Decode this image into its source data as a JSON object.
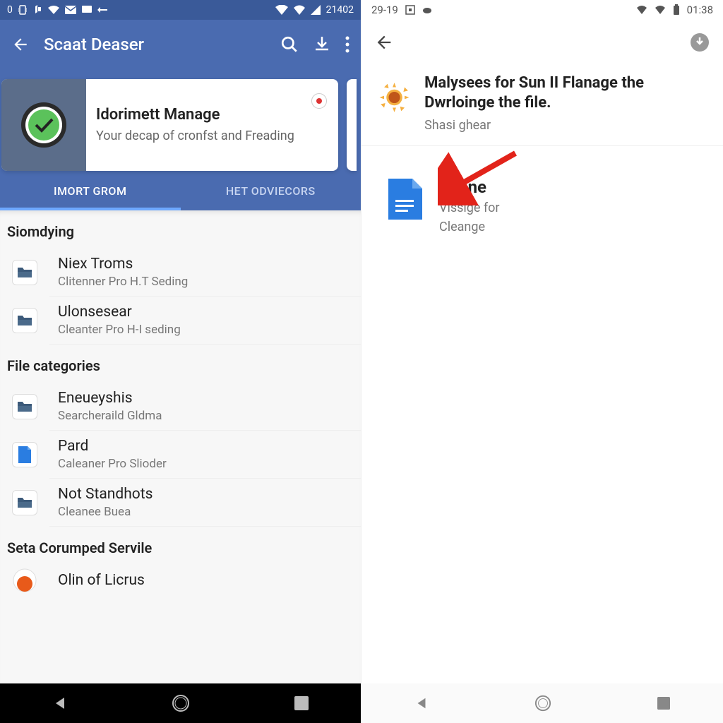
{
  "left": {
    "status": {
      "time": "21402"
    },
    "appbar": {
      "title": "Scaat Deaser"
    },
    "card": {
      "title": "Idorimett Manage",
      "subtitle": "Your decap of cronfst and Freading"
    },
    "tabs": [
      "IMORT GROM",
      "HET ODVIECORS"
    ],
    "sections": [
      {
        "header": "Siomdying",
        "items": [
          {
            "title": "Niex Troms",
            "subtitle": "Clitenner Pro H.T Seding",
            "icon": "folder"
          },
          {
            "title": "Ulonsesear",
            "subtitle": "Cleanter Pro H-I seding",
            "icon": "folder"
          }
        ]
      },
      {
        "header": "File categories",
        "items": [
          {
            "title": "Eneueyshis",
            "subtitle": "Searcheraild Gldma",
            "icon": "folder"
          },
          {
            "title": "Pard",
            "subtitle": "Caleaner Pro Slioder",
            "icon": "doc"
          },
          {
            "title": "Not Standhots",
            "subtitle": "Cleanee Buea",
            "icon": "folder"
          }
        ]
      },
      {
        "header": "Seta Corumped Servile",
        "items": [
          {
            "title": "Olin of Licrus",
            "subtitle": "",
            "icon": "orange"
          }
        ]
      }
    ]
  },
  "right": {
    "status": {
      "left": "29-19",
      "time": "01:38"
    },
    "header": {
      "title": "Malysees for Sun II Flanage the Dwrloinge the file.",
      "subtitle": "Shasi ghear"
    },
    "item": {
      "title": "Seane",
      "subtitle1": "Vissige for",
      "subtitle2": "Cleange"
    }
  }
}
